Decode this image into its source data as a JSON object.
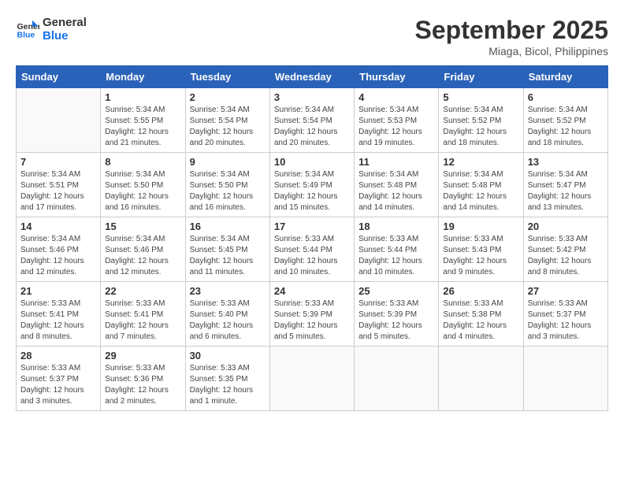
{
  "logo": {
    "line1": "General",
    "line2": "Blue"
  },
  "title": "September 2025",
  "subtitle": "Miaga, Bicol, Philippines",
  "days_of_week": [
    "Sunday",
    "Monday",
    "Tuesday",
    "Wednesday",
    "Thursday",
    "Friday",
    "Saturday"
  ],
  "weeks": [
    [
      {
        "day": "",
        "info": ""
      },
      {
        "day": "1",
        "info": "Sunrise: 5:34 AM\nSunset: 5:55 PM\nDaylight: 12 hours\nand 21 minutes."
      },
      {
        "day": "2",
        "info": "Sunrise: 5:34 AM\nSunset: 5:54 PM\nDaylight: 12 hours\nand 20 minutes."
      },
      {
        "day": "3",
        "info": "Sunrise: 5:34 AM\nSunset: 5:54 PM\nDaylight: 12 hours\nand 20 minutes."
      },
      {
        "day": "4",
        "info": "Sunrise: 5:34 AM\nSunset: 5:53 PM\nDaylight: 12 hours\nand 19 minutes."
      },
      {
        "day": "5",
        "info": "Sunrise: 5:34 AM\nSunset: 5:52 PM\nDaylight: 12 hours\nand 18 minutes."
      },
      {
        "day": "6",
        "info": "Sunrise: 5:34 AM\nSunset: 5:52 PM\nDaylight: 12 hours\nand 18 minutes."
      }
    ],
    [
      {
        "day": "7",
        "info": "Sunrise: 5:34 AM\nSunset: 5:51 PM\nDaylight: 12 hours\nand 17 minutes."
      },
      {
        "day": "8",
        "info": "Sunrise: 5:34 AM\nSunset: 5:50 PM\nDaylight: 12 hours\nand 16 minutes."
      },
      {
        "day": "9",
        "info": "Sunrise: 5:34 AM\nSunset: 5:50 PM\nDaylight: 12 hours\nand 16 minutes."
      },
      {
        "day": "10",
        "info": "Sunrise: 5:34 AM\nSunset: 5:49 PM\nDaylight: 12 hours\nand 15 minutes."
      },
      {
        "day": "11",
        "info": "Sunrise: 5:34 AM\nSunset: 5:48 PM\nDaylight: 12 hours\nand 14 minutes."
      },
      {
        "day": "12",
        "info": "Sunrise: 5:34 AM\nSunset: 5:48 PM\nDaylight: 12 hours\nand 14 minutes."
      },
      {
        "day": "13",
        "info": "Sunrise: 5:34 AM\nSunset: 5:47 PM\nDaylight: 12 hours\nand 13 minutes."
      }
    ],
    [
      {
        "day": "14",
        "info": "Sunrise: 5:34 AM\nSunset: 5:46 PM\nDaylight: 12 hours\nand 12 minutes."
      },
      {
        "day": "15",
        "info": "Sunrise: 5:34 AM\nSunset: 5:46 PM\nDaylight: 12 hours\nand 12 minutes."
      },
      {
        "day": "16",
        "info": "Sunrise: 5:34 AM\nSunset: 5:45 PM\nDaylight: 12 hours\nand 11 minutes."
      },
      {
        "day": "17",
        "info": "Sunrise: 5:33 AM\nSunset: 5:44 PM\nDaylight: 12 hours\nand 10 minutes."
      },
      {
        "day": "18",
        "info": "Sunrise: 5:33 AM\nSunset: 5:44 PM\nDaylight: 12 hours\nand 10 minutes."
      },
      {
        "day": "19",
        "info": "Sunrise: 5:33 AM\nSunset: 5:43 PM\nDaylight: 12 hours\nand 9 minutes."
      },
      {
        "day": "20",
        "info": "Sunrise: 5:33 AM\nSunset: 5:42 PM\nDaylight: 12 hours\nand 8 minutes."
      }
    ],
    [
      {
        "day": "21",
        "info": "Sunrise: 5:33 AM\nSunset: 5:41 PM\nDaylight: 12 hours\nand 8 minutes."
      },
      {
        "day": "22",
        "info": "Sunrise: 5:33 AM\nSunset: 5:41 PM\nDaylight: 12 hours\nand 7 minutes."
      },
      {
        "day": "23",
        "info": "Sunrise: 5:33 AM\nSunset: 5:40 PM\nDaylight: 12 hours\nand 6 minutes."
      },
      {
        "day": "24",
        "info": "Sunrise: 5:33 AM\nSunset: 5:39 PM\nDaylight: 12 hours\nand 5 minutes."
      },
      {
        "day": "25",
        "info": "Sunrise: 5:33 AM\nSunset: 5:39 PM\nDaylight: 12 hours\nand 5 minutes."
      },
      {
        "day": "26",
        "info": "Sunrise: 5:33 AM\nSunset: 5:38 PM\nDaylight: 12 hours\nand 4 minutes."
      },
      {
        "day": "27",
        "info": "Sunrise: 5:33 AM\nSunset: 5:37 PM\nDaylight: 12 hours\nand 3 minutes."
      }
    ],
    [
      {
        "day": "28",
        "info": "Sunrise: 5:33 AM\nSunset: 5:37 PM\nDaylight: 12 hours\nand 3 minutes."
      },
      {
        "day": "29",
        "info": "Sunrise: 5:33 AM\nSunset: 5:36 PM\nDaylight: 12 hours\nand 2 minutes."
      },
      {
        "day": "30",
        "info": "Sunrise: 5:33 AM\nSunset: 5:35 PM\nDaylight: 12 hours\nand 1 minute."
      },
      {
        "day": "",
        "info": ""
      },
      {
        "day": "",
        "info": ""
      },
      {
        "day": "",
        "info": ""
      },
      {
        "day": "",
        "info": ""
      }
    ]
  ]
}
